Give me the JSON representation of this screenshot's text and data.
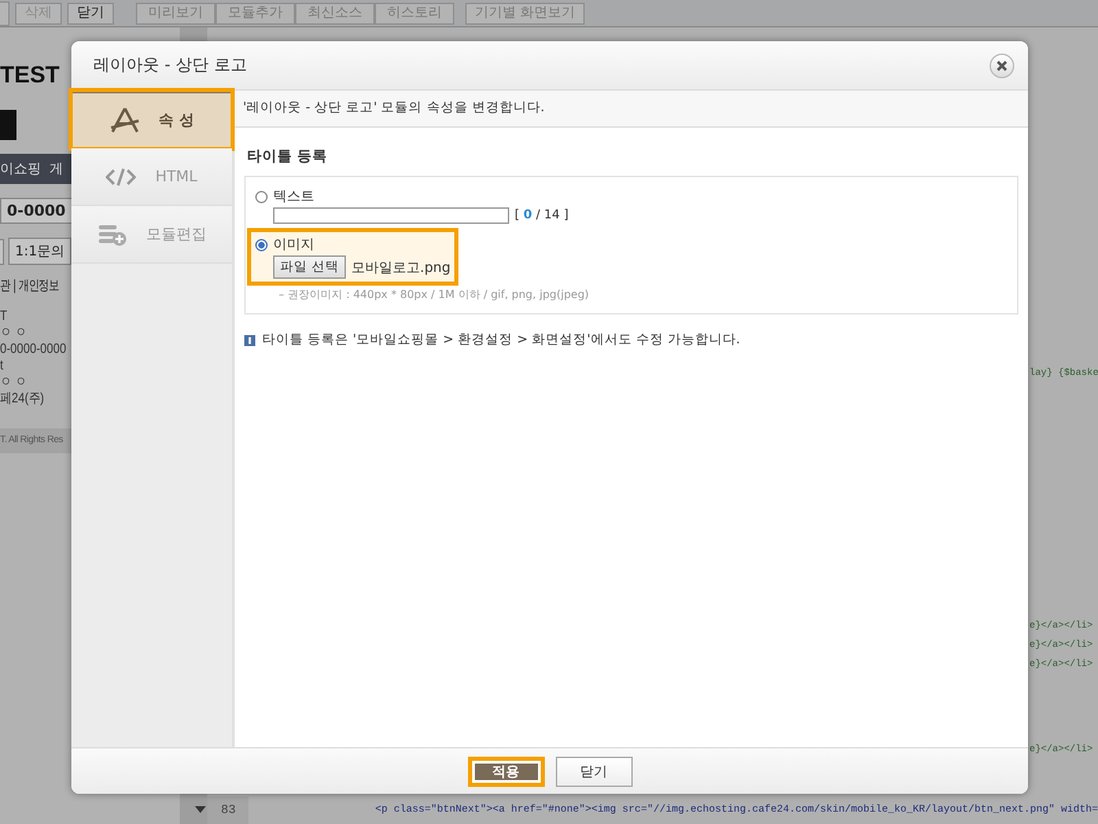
{
  "toolbar": {
    "buttons": [
      {
        "label": "삭제",
        "disabled": true
      },
      {
        "label": "닫기",
        "disabled": false
      }
    ],
    "group": [
      "미리보기",
      "모듈추가",
      "최신소스",
      "히스토리"
    ],
    "device_button": "기기별 화면보기"
  },
  "preview": {
    "logo": "TEST",
    "nav": [
      "이쇼핑",
      "게"
    ],
    "phone_button": "0-0000",
    "inquiry_button": "1:1문의",
    "footer_links": "관 | 개인정보",
    "info_lines": [
      "T",
      "ㅇ ㅇ",
      "0-0000-0000",
      "t",
      "ㅇ ㅇ",
      "페24(주)"
    ],
    "copyright": "T. All Rights Res"
  },
  "editor": {
    "side_lines": [
      "lay} {$baske",
      "e}</a></li>",
      "e}</a></li>",
      "e}</a></li>",
      "e}</a></li>"
    ],
    "bottom_line": {
      "number": "83",
      "code": "<p class=\"btnNext\"><a href=\"#none\"><img src=\"//img.echosting.cafe24.com/skin/mobile_ko_KR/layout/btn_next.png\" width="
    }
  },
  "dialog": {
    "title": "레이아웃 - 상단 로고",
    "tabs": [
      {
        "label": "속 성",
        "kind": "properties",
        "selected": true,
        "highlighted": true
      },
      {
        "label": "HTML",
        "kind": "html",
        "selected": false,
        "highlighted": false
      },
      {
        "label": "모듈편집",
        "kind": "module",
        "selected": false,
        "highlighted": false
      }
    ],
    "info": "'레이아웃 - 상단 로고' 모듈의 속성을 변경합니다.",
    "section_title": "타이틀 등록",
    "options": [
      {
        "label": "텍스트",
        "kind": "text",
        "selected": false,
        "highlighted": false,
        "counter": {
          "open": "[",
          "value": "0",
          "rest": "/ 14 ]"
        }
      },
      {
        "label": "이미지",
        "kind": "image",
        "selected": true,
        "highlighted": true,
        "file_button": "파일 선택",
        "file_name": "모바일로고.png"
      }
    ],
    "hint": "– 권장이미지 : 440px * 80px / 1M 이하 / gif, png, jpg(jpeg)",
    "note": "타이틀 등록은 '모바일쇼핑몰 > 환경설정 > 화면설정'에서도 수정 가능합니다.",
    "buttons": [
      {
        "label": "적용",
        "kind": "primary",
        "highlighted": true
      },
      {
        "label": "닫기",
        "kind": "secondary",
        "highlighted": false
      }
    ]
  }
}
